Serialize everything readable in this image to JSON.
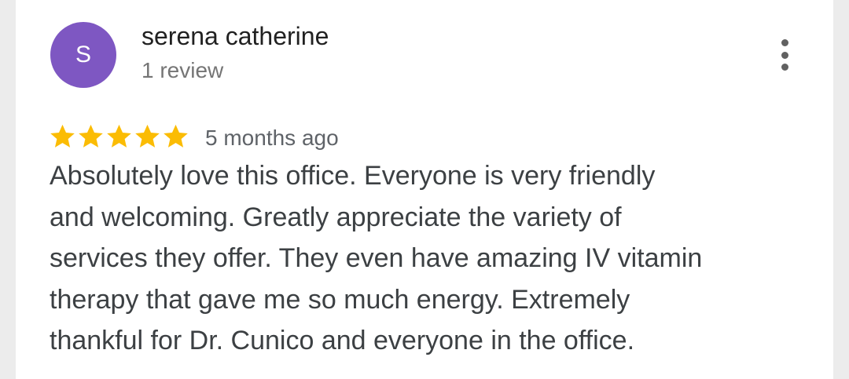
{
  "reviewer": {
    "avatar_initial": "S",
    "avatar_color": "#7e57c2",
    "name": "serena catherine",
    "review_count": "1 review"
  },
  "review": {
    "rating": 5,
    "max_rating": 5,
    "star_color": "#fbbc04",
    "time_ago": "5 months ago",
    "text": "Absolutely love this office. Everyone is very friendly\nand welcoming.  Greatly appreciate the variety of\nservices they offer. They even have amazing IV vitamin\ntherapy that gave me so much energy. Extremely\nthankful for Dr. Cunico and everyone in the office."
  },
  "actions": {
    "more_icon": "more-vertical-icon"
  }
}
